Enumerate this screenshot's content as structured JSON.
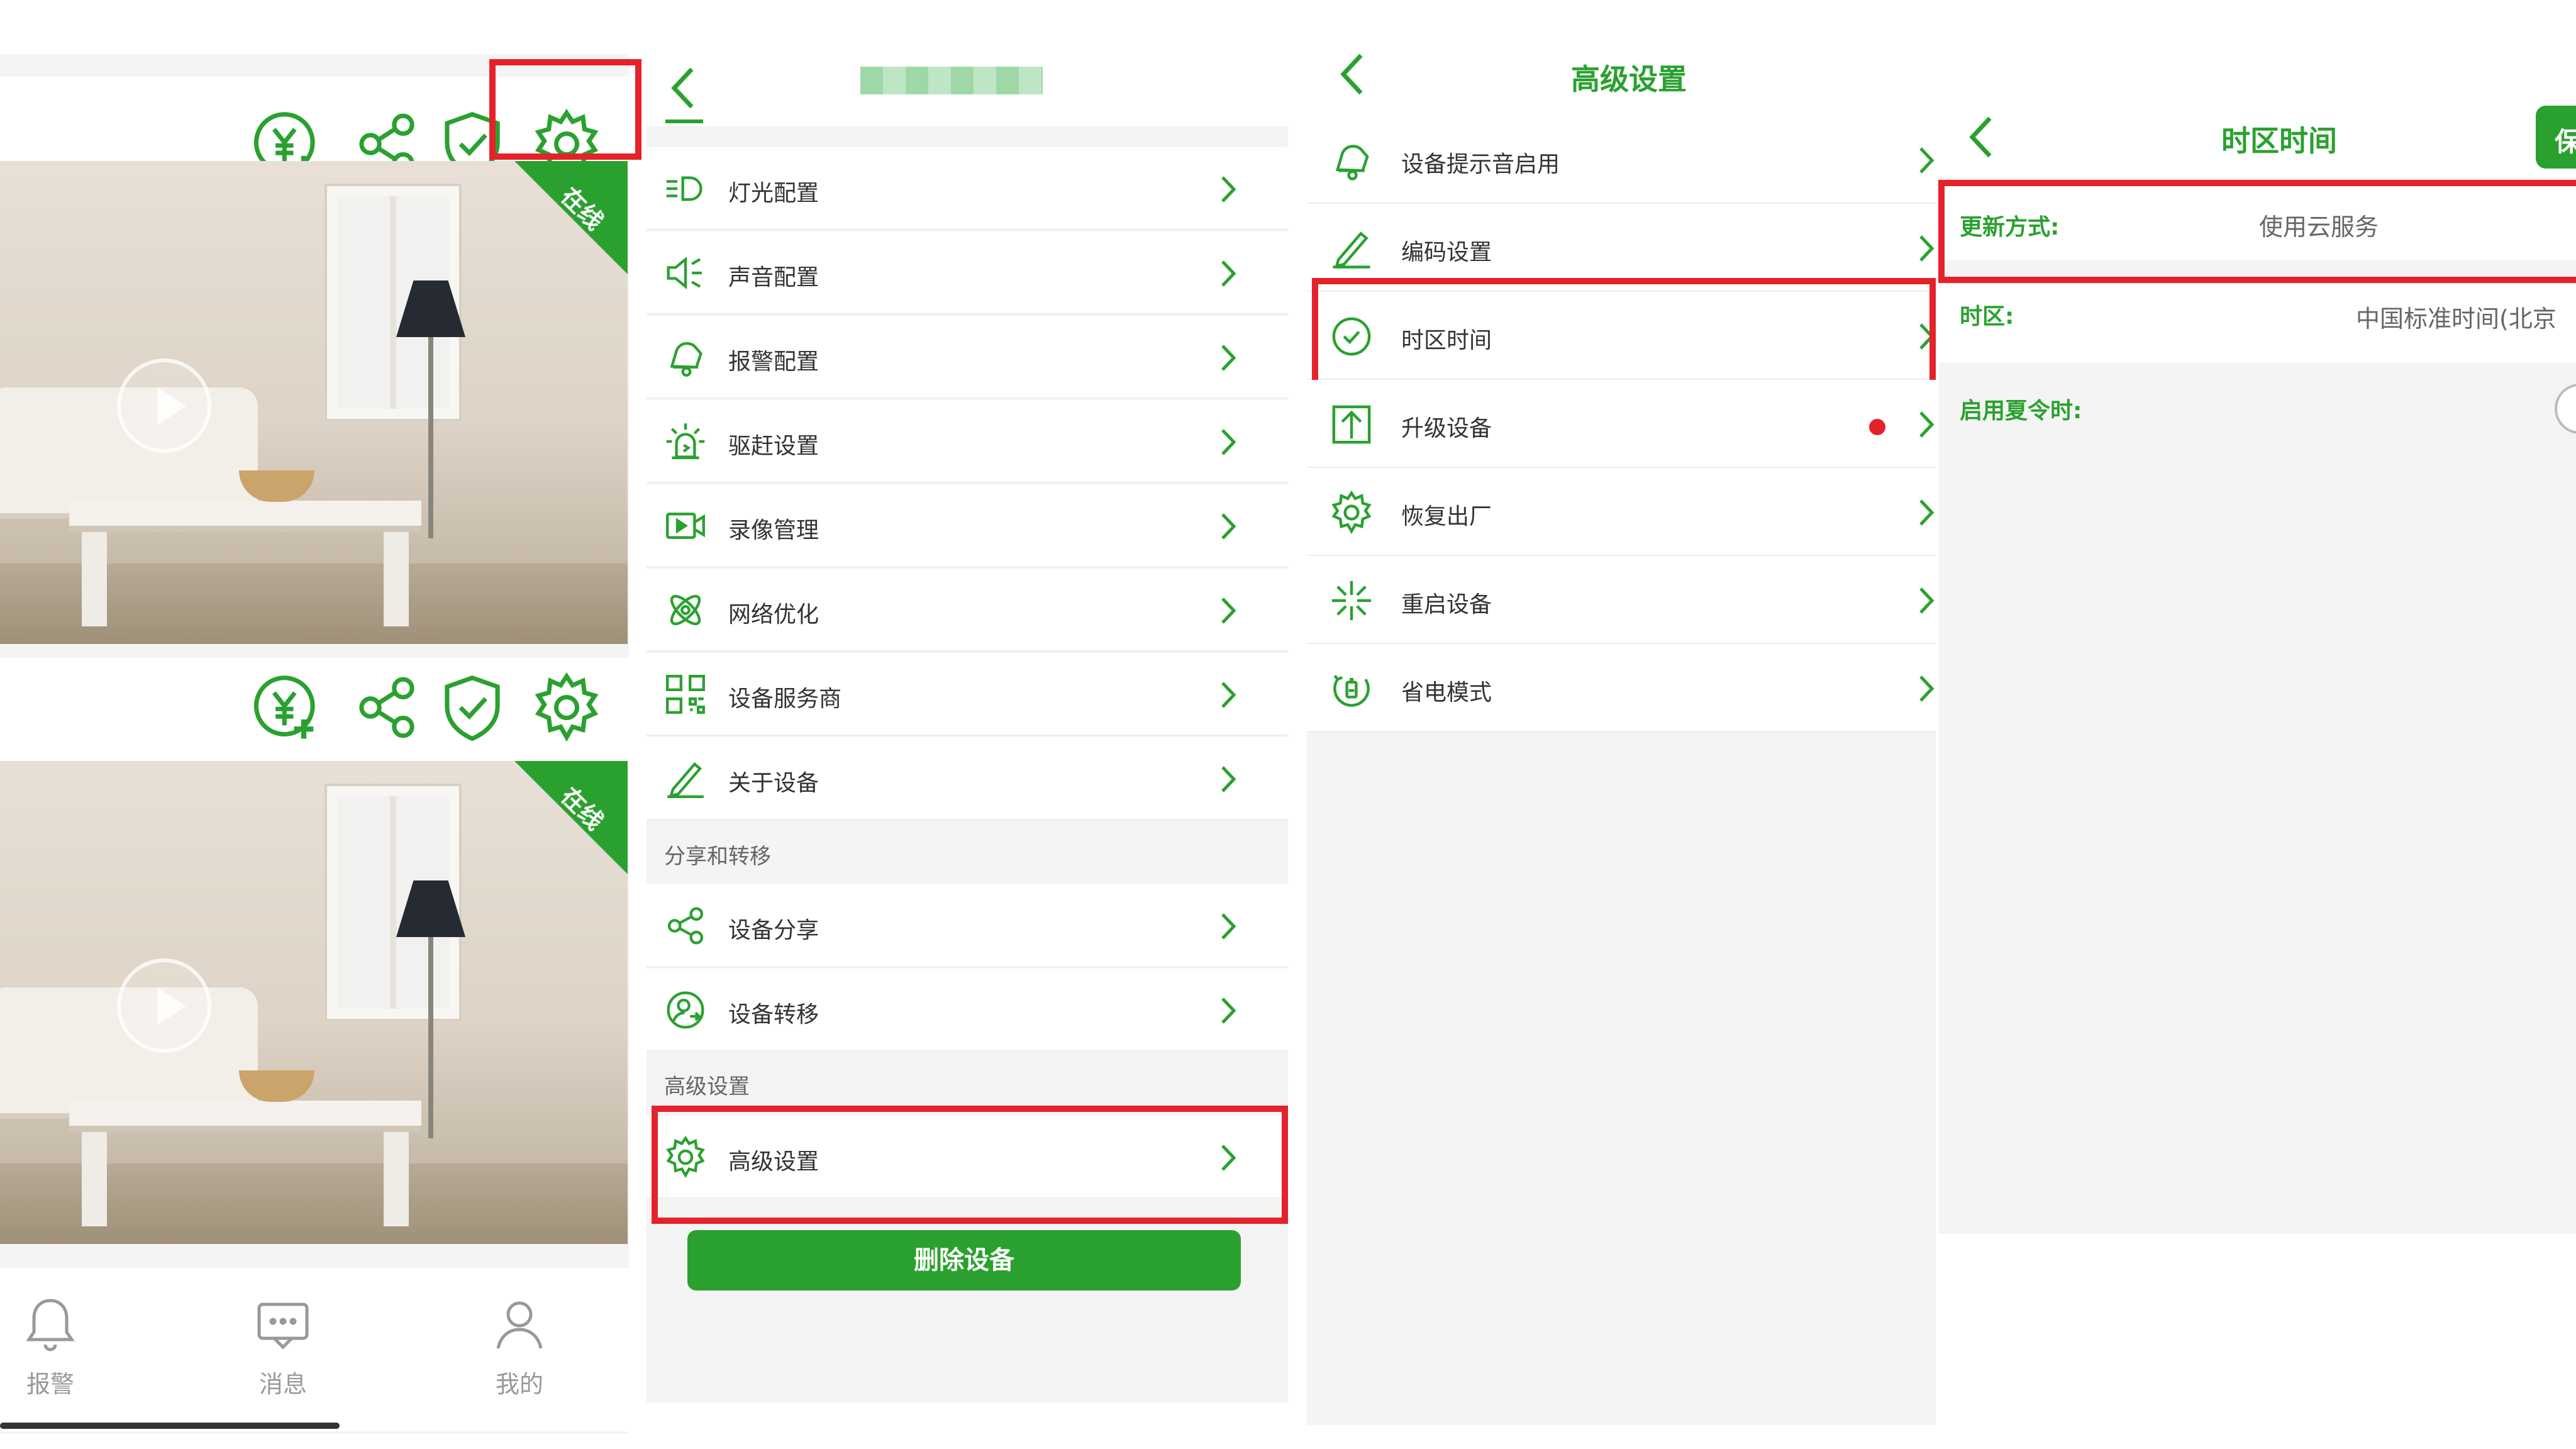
{
  "colors": {
    "accent": "#2aa12f",
    "highlight": "#e5222a",
    "background": "#f4f4f4",
    "surface": "#ffffff"
  },
  "device_list": {
    "cards": [
      {
        "badge": "在线",
        "toolbar_icons": [
          "yuan-plus-icon",
          "share-icon",
          "shield-check-icon",
          "gear-icon"
        ]
      },
      {
        "badge": "在线",
        "toolbar_icons": [
          "yuan-plus-icon",
          "share-icon",
          "shield-check-icon",
          "gear-icon"
        ]
      }
    ],
    "bottom_nav": [
      {
        "label": "报警",
        "icon": "bell-icon"
      },
      {
        "label": "消息",
        "icon": "message-icon"
      },
      {
        "label": "我的",
        "icon": "person-icon"
      }
    ]
  },
  "settings": {
    "items": [
      {
        "label": "灯光配置",
        "icon": "light-icon"
      },
      {
        "label": "声音配置",
        "icon": "speaker-icon"
      },
      {
        "label": "报警配置",
        "icon": "alarm-bell-icon"
      },
      {
        "label": "驱赶设置",
        "icon": "siren-icon"
      },
      {
        "label": "录像管理",
        "icon": "video-record-icon"
      },
      {
        "label": "网络优化",
        "icon": "network-icon"
      },
      {
        "label": "设备服务商",
        "icon": "qr-code-icon"
      },
      {
        "label": "关于设备",
        "icon": "pencil-icon"
      }
    ],
    "section_share": "分享和转移",
    "share_items": [
      {
        "label": "设备分享",
        "icon": "share-icon"
      },
      {
        "label": "设备转移",
        "icon": "transfer-user-icon"
      }
    ],
    "section_advanced": "高级设置",
    "advanced_item": {
      "label": "高级设置",
      "icon": "gear-icon"
    },
    "delete_label": "删除设备"
  },
  "advanced": {
    "title": "高级设置",
    "items": [
      {
        "label": "设备提示音启用",
        "icon": "bell-icon"
      },
      {
        "label": "编码设置",
        "icon": "pencil-icon"
      },
      {
        "label": "时区时间",
        "icon": "clock-icon"
      },
      {
        "label": "升级设备",
        "icon": "upload-icon",
        "red_dot": true
      },
      {
        "label": "恢复出厂",
        "icon": "gear-icon"
      },
      {
        "label": "重启设备",
        "icon": "restart-icon"
      },
      {
        "label": "省电模式",
        "icon": "power-save-icon"
      }
    ]
  },
  "timezone": {
    "title": "时区时间",
    "save_label": "保",
    "update_method_key": "更新方式:",
    "update_method_value": "使用云服务",
    "zone_key": "时区:",
    "zone_value": "中国标准时间(北京",
    "dst_key": "启用夏令时:"
  }
}
